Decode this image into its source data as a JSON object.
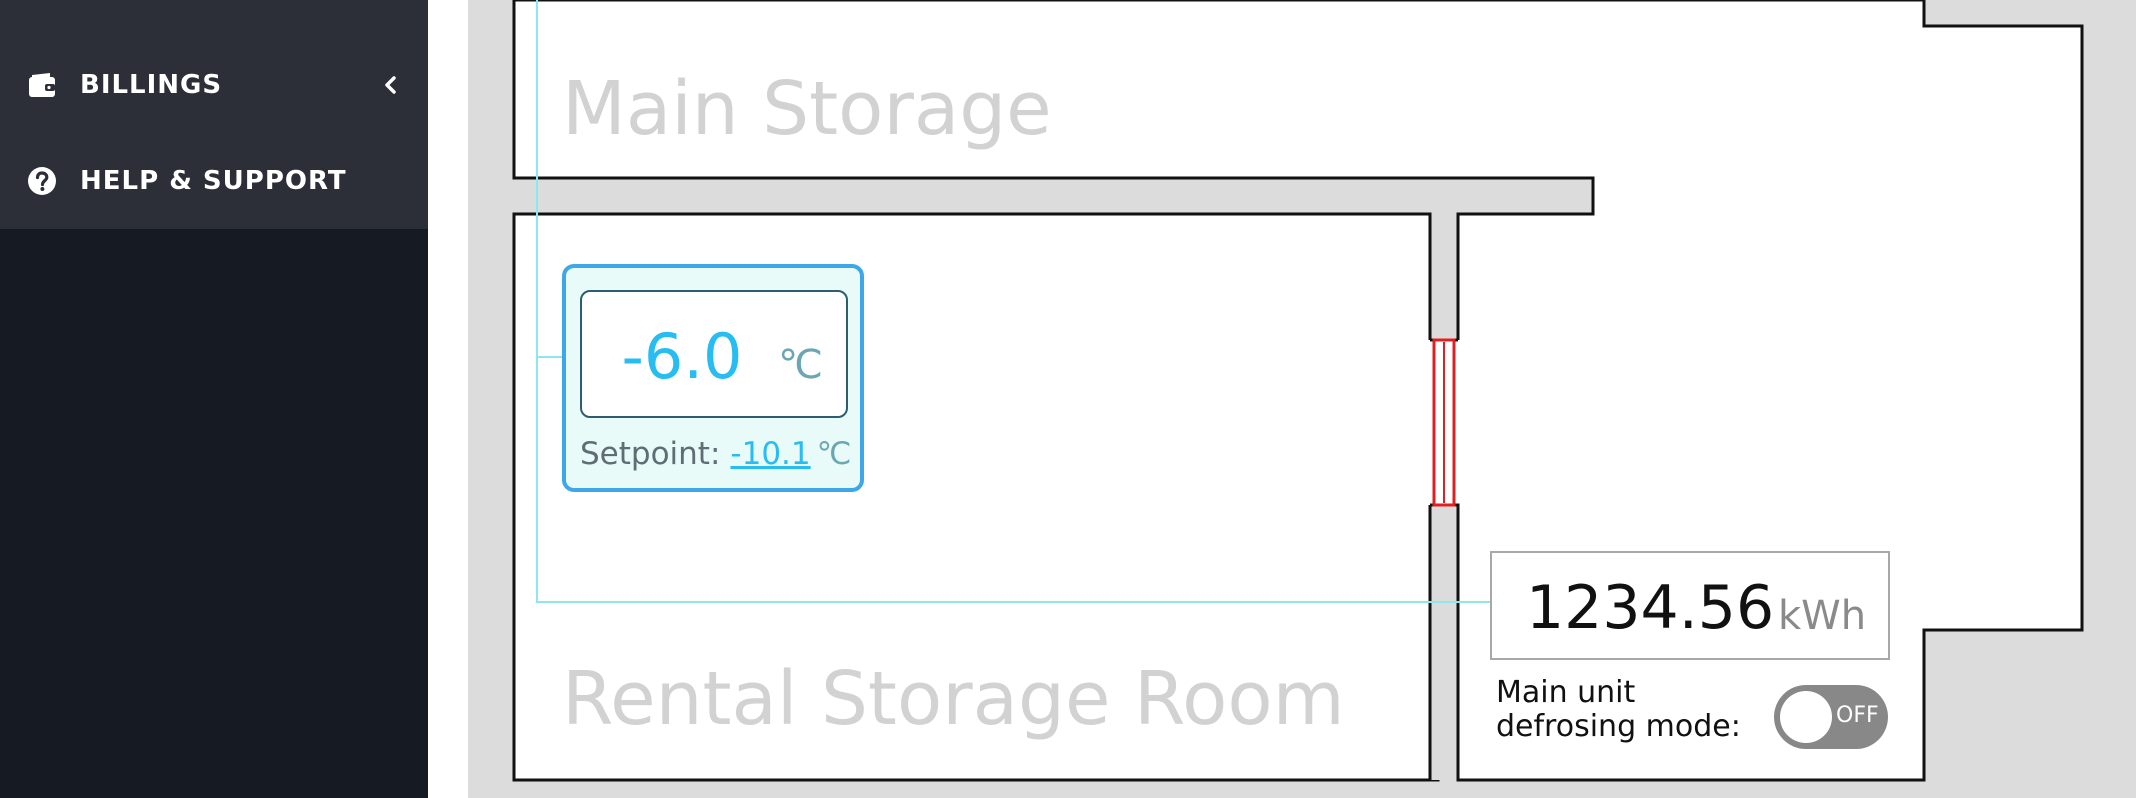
{
  "sidebar": {
    "items": [
      {
        "label": "BILLINGS",
        "icon": "wallet-icon",
        "expandable": true
      },
      {
        "label": "HELP & SUPPORT",
        "icon": "question-circle-icon"
      }
    ]
  },
  "floorplan": {
    "rooms": [
      {
        "label": "Main Storage"
      },
      {
        "label": "Rental Storage Room"
      }
    ],
    "temperature_sensor": {
      "value": "-6.0",
      "unit": "℃",
      "setpoint_label": "Setpoint:",
      "setpoint_value": "-10.1",
      "setpoint_unit": "℃"
    },
    "energy_meter": {
      "value": "1234.56",
      "unit": "kWh"
    },
    "defrost": {
      "label_line1": "Main unit",
      "label_line2": "defrosing mode:",
      "toggle_text": "OFF",
      "on": false
    }
  },
  "colors": {
    "sidebar_bg": "#151a23",
    "menu_bg": "#2c2f38",
    "accent": "#27bdf2",
    "widget_border": "#3ea7ea",
    "door": "#e02020"
  }
}
